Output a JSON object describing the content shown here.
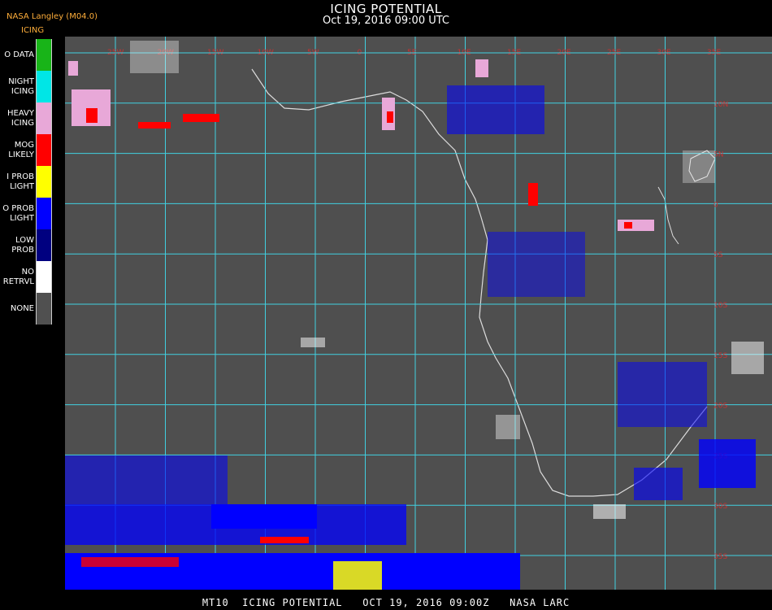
{
  "header": {
    "title": "ICING POTENTIAL",
    "subtitle": "Oct 19, 2016 09:00 UTC",
    "producer": "NASA Langley (M04.0)",
    "legend_title": "ICING"
  },
  "legend": {
    "items": [
      {
        "label": "O DATA",
        "color": "#18b418"
      },
      {
        "label": "NIGHT\nICING",
        "color": "#00e6e6"
      },
      {
        "label": "HEAVY\nICING",
        "color": "#e8a8d8"
      },
      {
        "label": "MOG\nLIKELY",
        "color": "#ff0000"
      },
      {
        "label": "I PROB\nLIGHT",
        "color": "#ffff00"
      },
      {
        "label": "O PROB\nLIGHT",
        "color": "#0000ff"
      },
      {
        "label": "LOW\nPROB",
        "color": "#000080"
      },
      {
        "label": "NO\nRETRVL",
        "color": "#ffffff"
      },
      {
        "label": "NONE",
        "color": "#505050"
      }
    ]
  },
  "map": {
    "background_color": "#4f4f4f",
    "grid_color": "#40d0e0",
    "coast_color": "#dcdcdc",
    "lon_labels": [
      "25W",
      "20W",
      "15W",
      "10W",
      "5W",
      "0",
      "5E",
      "10E",
      "15E",
      "20E",
      "25E",
      "30E",
      "35E"
    ],
    "lat_labels": [
      "10N",
      "5N",
      "0",
      "5S",
      "10S",
      "15S",
      "20S",
      "25S",
      "30S",
      "35S"
    ]
  },
  "footer": {
    "text": "MT10  ICING POTENTIAL   OCT 19, 2016 09:00Z   NASA LARC"
  }
}
